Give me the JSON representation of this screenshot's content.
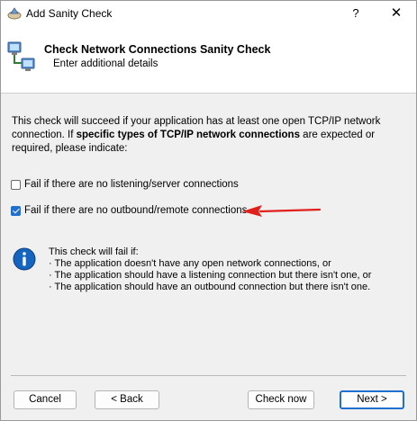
{
  "window": {
    "title": "Add Sanity Check",
    "help_label": "?",
    "close_label": "✕"
  },
  "header": {
    "title": "Check Network Connections Sanity Check",
    "subtitle": "Enter additional details"
  },
  "intro": {
    "part1": "This check will succeed if your application has at least one open TCP/IP network connection. If ",
    "bold": "specific types of TCP/IP network connections",
    "part2": " are expected or required, please indicate:"
  },
  "options": [
    {
      "label": "Fail if there are no listening/server connections",
      "checked": false
    },
    {
      "label": "Fail if there are no outbound/remote connections",
      "checked": true
    }
  ],
  "info": {
    "heading": "This check will fail if:",
    "items": [
      "· The application doesn't have any open network connections, or",
      "· The application should have a listening connection but there isn't one, or",
      "· The application should have an outbound connection but there isn't one."
    ]
  },
  "buttons": {
    "cancel": "Cancel",
    "back": "< Back",
    "check_now": "Check now",
    "next": "Next >"
  },
  "colors": {
    "accent": "#1f6fd0",
    "arrow": "#e0201b",
    "info_blue": "#1565c0"
  }
}
